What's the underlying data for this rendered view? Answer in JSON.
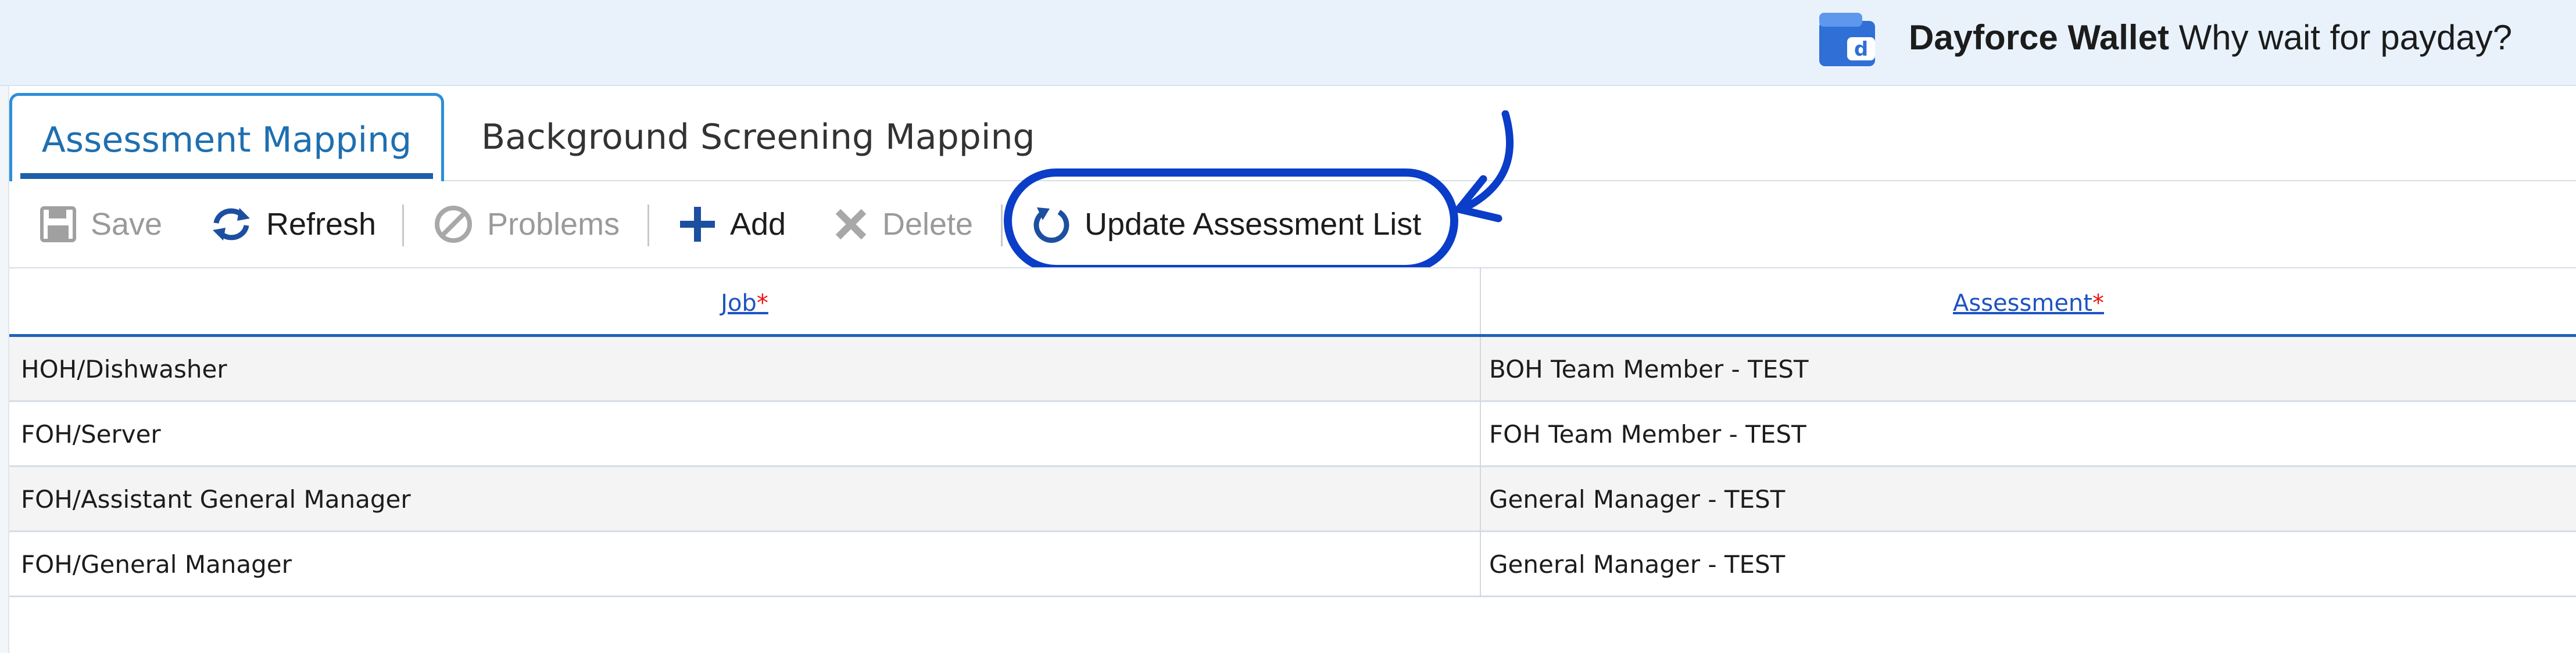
{
  "banner": {
    "brand": "Dayforce Wallet",
    "tagline": "Why wait for payday?",
    "icon": "wallet-icon",
    "background": "#e9f2fb"
  },
  "tabs": [
    {
      "label": "Assessment Mapping",
      "active": true
    },
    {
      "label": "Background Screening Mapping",
      "active": false
    }
  ],
  "toolbar": {
    "save_label": "Save",
    "refresh_label": "Refresh",
    "problems_label": "Problems",
    "add_label": "Add",
    "delete_label": "Delete",
    "update_label": "Update Assessment List"
  },
  "grid": {
    "columns": [
      {
        "label": "Job",
        "required": "*"
      },
      {
        "label": "Assessment",
        "required": "*"
      }
    ],
    "rows": [
      {
        "job": "HOH/Dishwasher",
        "assessment": "BOH Team Member - TEST"
      },
      {
        "job": "FOH/Server",
        "assessment": "FOH Team Member - TEST"
      },
      {
        "job": "FOH/Assistant General Manager",
        "assessment": "General Manager - TEST"
      },
      {
        "job": "FOH/General Manager",
        "assessment": "General Manager - TEST"
      }
    ]
  },
  "colors": {
    "accent": "#1d63b8",
    "annotation": "#0a3dc8",
    "required": "#e11111",
    "disabled": "#9a9a9a"
  }
}
